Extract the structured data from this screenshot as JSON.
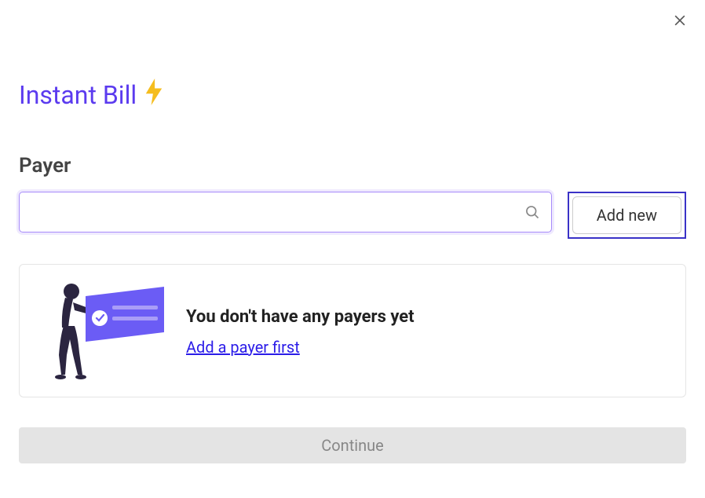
{
  "header": {
    "title": "Instant Bill"
  },
  "payer": {
    "label": "Payer",
    "search_value": "",
    "search_placeholder": "",
    "add_new_label": "Add new"
  },
  "empty_state": {
    "heading": "You don't have any payers yet",
    "link_text": "Add a payer first"
  },
  "footer": {
    "continue_label": "Continue"
  }
}
